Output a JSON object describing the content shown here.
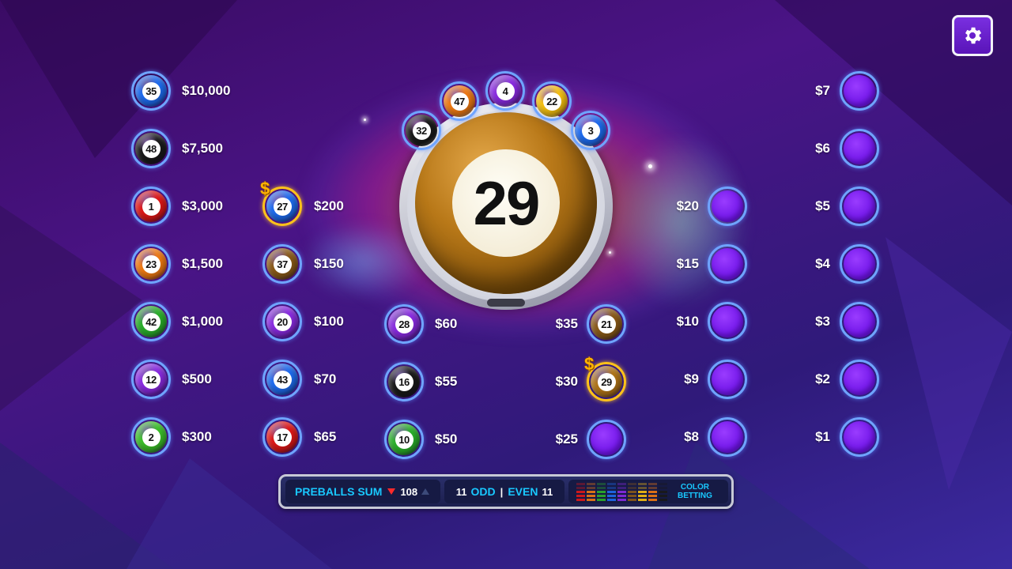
{
  "drawn_ball": {
    "number": "29",
    "color": "#b07418"
  },
  "preballs": [
    {
      "number": "32",
      "color": "#1a1a1a"
    },
    {
      "number": "47",
      "color": "#f07a12"
    },
    {
      "number": "4",
      "color": "#8a2be2"
    },
    {
      "number": "22",
      "color": "#f5c010"
    },
    {
      "number": "3",
      "color": "#1e6cf0"
    }
  ],
  "columns": {
    "col1": [
      {
        "number": "35",
        "color": "#1e6cf0",
        "prize": "$10,000"
      },
      {
        "number": "48",
        "color": "#1a1a1a",
        "prize": "$7,500"
      },
      {
        "number": "1",
        "color": "#e01818",
        "prize": "$3,000"
      },
      {
        "number": "23",
        "color": "#f07a12",
        "prize": "$1,500"
      },
      {
        "number": "42",
        "color": "#2ab02a",
        "prize": "$1,000"
      },
      {
        "number": "12",
        "color": "#8a2be2",
        "prize": "$500"
      },
      {
        "number": "2",
        "color": "#3cc02a",
        "prize": "$300"
      }
    ],
    "col2": [
      {
        "number": "27",
        "color": "#1e6cf0",
        "prize": "$200",
        "gold": true
      },
      {
        "number": "37",
        "color": "#8a5a18",
        "prize": "$150"
      },
      {
        "number": "20",
        "color": "#8a2be2",
        "prize": "$100"
      },
      {
        "number": "43",
        "color": "#1e6cf0",
        "prize": "$70"
      },
      {
        "number": "17",
        "color": "#e01818",
        "prize": "$65"
      }
    ],
    "col3": [
      {
        "number": "28",
        "color": "#8a2be2",
        "prize": "$60"
      },
      {
        "number": "16",
        "color": "#1a1a1a",
        "prize": "$55"
      },
      {
        "number": "10",
        "color": "#2ab02a",
        "prize": "$50"
      }
    ],
    "col4": [
      {
        "number": "21",
        "color": "#8a5a18",
        "prize": "$35"
      },
      {
        "number": "29",
        "color": "#b07418",
        "prize": "$30",
        "gold": true
      },
      {
        "number": "",
        "color": "",
        "prize": "$25"
      }
    ],
    "col5": [
      {
        "prize": "$20"
      },
      {
        "prize": "$15"
      },
      {
        "prize": "$10"
      },
      {
        "prize": "$9"
      },
      {
        "prize": "$8"
      }
    ],
    "col6": [
      {
        "prize": "$7"
      },
      {
        "prize": "$6"
      },
      {
        "prize": "$5"
      },
      {
        "prize": "$4"
      },
      {
        "prize": "$3"
      },
      {
        "prize": "$2"
      },
      {
        "prize": "$1"
      }
    ]
  },
  "bottom_bar": {
    "preballs_sum_label": "PREBALLS SUM",
    "preballs_sum_value": "108",
    "odd_count": "11",
    "odd_label": "ODD",
    "divider": "|",
    "even_label": "EVEN",
    "even_count": "11",
    "color_betting_line1": "COLOR",
    "color_betting_line2": "BETTING",
    "color_bars": [
      "#e01818",
      "#f07a12",
      "#2ab02a",
      "#1e6cf0",
      "#8a2be2",
      "#8a5a18",
      "#f5c010",
      "#f07a12",
      "#1a1a1a"
    ]
  },
  "icons": {
    "settings": "gear-icon"
  }
}
